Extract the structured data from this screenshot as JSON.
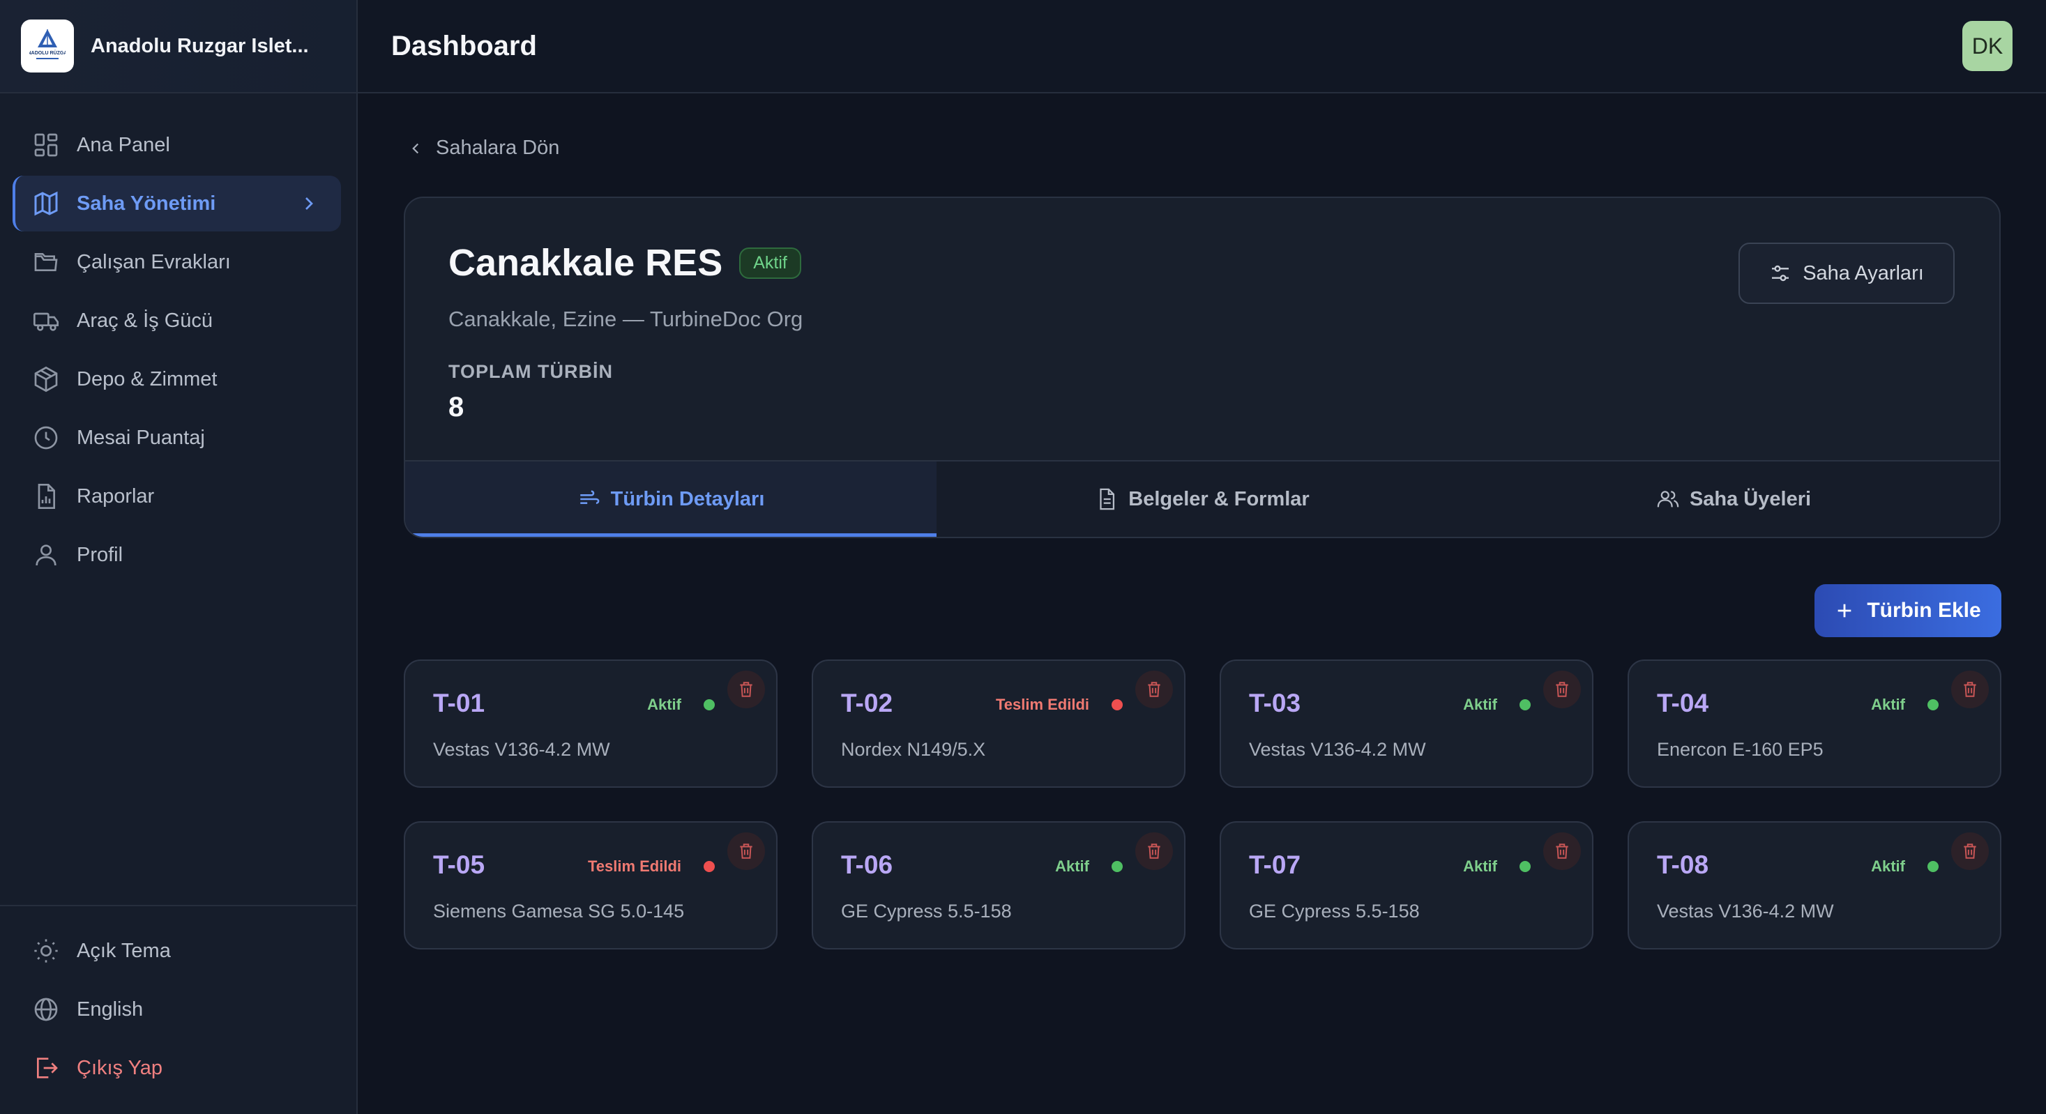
{
  "brand": {
    "name": "Anadolu Ruzgar Islet...",
    "logo_text": "ANADOLU RÜZGAR"
  },
  "sidebar": {
    "items": [
      {
        "label": "Ana Panel",
        "icon": "grid-icon"
      },
      {
        "label": "Saha Yönetimi",
        "icon": "map-icon",
        "active": true
      },
      {
        "label": "Çalışan Evrakları",
        "icon": "folder-icon"
      },
      {
        "label": "Araç & İş Gücü",
        "icon": "truck-icon"
      },
      {
        "label": "Depo & Zimmet",
        "icon": "box-icon"
      },
      {
        "label": "Mesai Puantaj",
        "icon": "clock-icon"
      },
      {
        "label": "Raporlar",
        "icon": "report-icon"
      },
      {
        "label": "Profil",
        "icon": "user-icon"
      }
    ],
    "bottom": [
      {
        "label": "Açık Tema",
        "icon": "sun-icon"
      },
      {
        "label": "English",
        "icon": "globe-icon"
      },
      {
        "label": "Çıkış Yap",
        "icon": "logout-icon"
      }
    ]
  },
  "header": {
    "title": "Dashboard",
    "avatar": "DK"
  },
  "main": {
    "back_label": "Sahalara Dön",
    "site": {
      "name": "Canakkale RES",
      "status": "Aktif",
      "subtitle": "Canakkale, Ezine — TurbineDoc Org",
      "stat_label": "TOPLAM TÜRBİN",
      "stat_value": "8",
      "settings_label": "Saha Ayarları"
    },
    "tabs": [
      {
        "label": "Türbin Detayları",
        "active": true
      },
      {
        "label": "Belgeler & Formlar"
      },
      {
        "label": "Saha Üyeleri"
      }
    ],
    "add_label": "Türbin Ekle"
  },
  "turbines": [
    {
      "id": "T-01",
      "status": "Aktif",
      "state": "ok",
      "model": "Vestas V136-4.2 MW"
    },
    {
      "id": "T-02",
      "status": "Teslim Edildi",
      "state": "bad",
      "model": "Nordex N149/5.X"
    },
    {
      "id": "T-03",
      "status": "Aktif",
      "state": "ok",
      "model": "Vestas V136-4.2 MW"
    },
    {
      "id": "T-04",
      "status": "Aktif",
      "state": "ok",
      "model": "Enercon E-160 EP5"
    },
    {
      "id": "T-05",
      "status": "Teslim Edildi",
      "state": "bad",
      "model": "Siemens Gamesa SG 5.0-145"
    },
    {
      "id": "T-06",
      "status": "Aktif",
      "state": "ok",
      "model": "GE Cypress 5.5-158"
    },
    {
      "id": "T-07",
      "status": "Aktif",
      "state": "ok",
      "model": "GE Cypress 5.5-158"
    },
    {
      "id": "T-08",
      "status": "Aktif",
      "state": "ok",
      "model": "Vestas V136-4.2 MW"
    }
  ],
  "colors": {
    "accent": "#4f7fe8",
    "active_green": "#4fbf63",
    "delivered_red": "#ee4f4f",
    "background": "#0f1420"
  }
}
